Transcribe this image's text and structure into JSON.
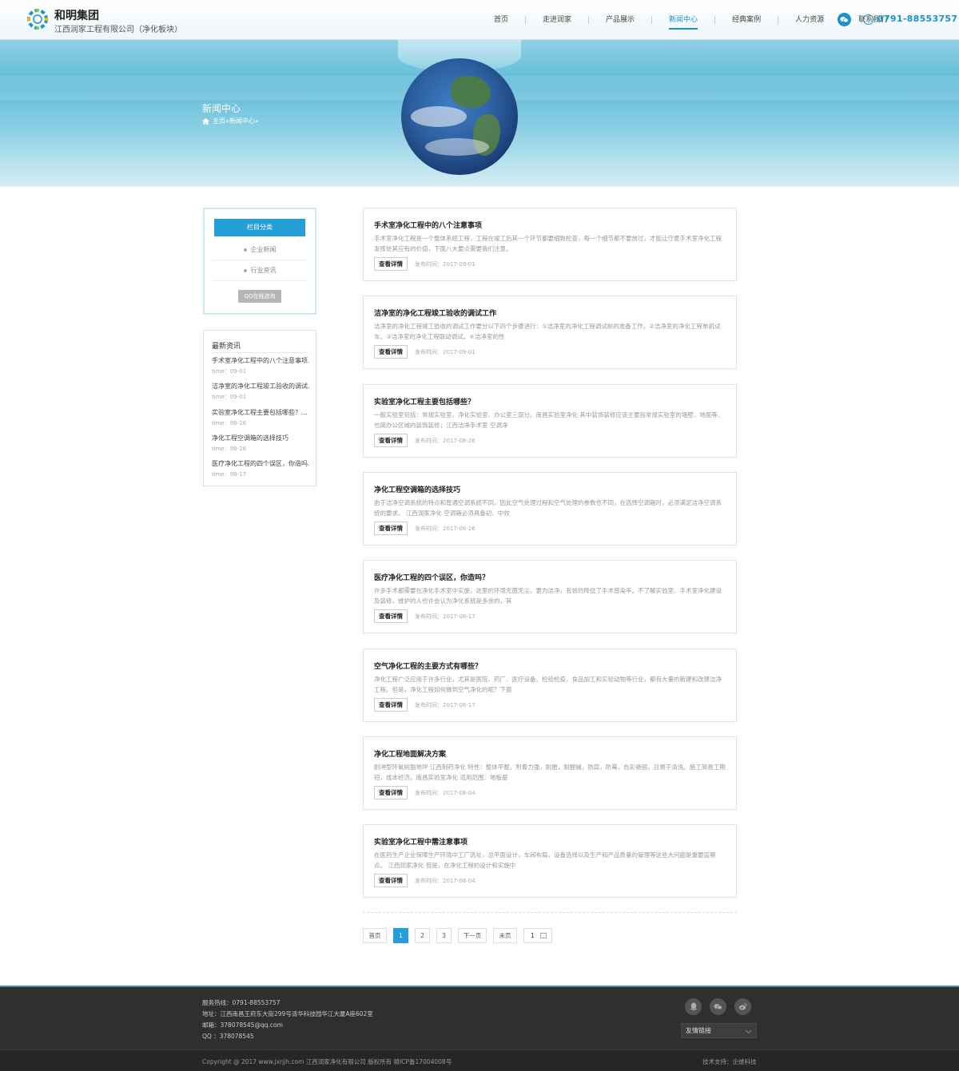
{
  "header": {
    "brand_title": "和明集团",
    "brand_sub": "江西润家工程有限公司（净化板块）",
    "phone": "0791-88553757",
    "accent": "#1a93c9"
  },
  "nav": [
    {
      "label": "首页",
      "active": false
    },
    {
      "label": "走进润家",
      "active": false
    },
    {
      "label": "产品展示",
      "active": false
    },
    {
      "label": "新闻中心",
      "active": true
    },
    {
      "label": "经典案例",
      "active": false
    },
    {
      "label": "人力资源",
      "active": false
    },
    {
      "label": "联系我们",
      "active": false
    }
  ],
  "banner": {
    "title": "新闻中心",
    "crumb_home": "主页",
    "crumb_sep1": " » ",
    "crumb_current": "新闻中心",
    "crumb_sep2": " »"
  },
  "sidebar": {
    "category_title": "栏目分类",
    "categories": [
      "企业新闻",
      "行业资讯"
    ],
    "qq_button": "QQ在线咨询",
    "latest_title": "最新资讯",
    "latest": [
      {
        "title": "手术室净化工程中的八个注意事项...",
        "date": "time：09-01"
      },
      {
        "title": "洁净室的净化工程竣工验收的调试...",
        "date": "time：09-01"
      },
      {
        "title": "实验室净化工程主要包括哪些？...",
        "date": "time：08-26"
      },
      {
        "title": "净化工程空调箱的选择技巧",
        "date": "time：08-26"
      },
      {
        "title": "医疗净化工程的四个误区，你造吗...",
        "date": "time：08-17"
      }
    ]
  },
  "articles": [
    {
      "title": "手术室净化工程中的八个注意事项",
      "desc": "手术室净化工程是一个整体系统工程，工程在竣工后其一个环节都要细致检查，每一个细节都不要放过，才能让守夏手术室净化工程发挥处其应有的价值，下面八大要点需要我们注意。",
      "more": "查看详情",
      "date": "发布时间：2017-09-01"
    },
    {
      "title": "洁净室的净化工程竣工验收的调试工作",
      "desc": "洁净室的净化工程竣工验收的调试工作要分以下四个步骤进行：①洁净室的净化工程调试前的准备工作。②洁净室的净化工程单机试车。③洁净室的净化工程联动调试。④洁净室的性",
      "more": "查看详情",
      "date": "发布时间：2017-09-01"
    },
    {
      "title": "实验室净化工程主要包括哪些？",
      "desc": "一般实验室包括：常规实验室、净化实验室、办公室三部分。南昌实验室净化 其中装饰装修应该主要指常规实验室的墙壁、地面等、也简办公区域的装饰装修；江西洁净手术室 空调净",
      "more": "查看详情",
      "date": "发布时间：2017-08-26"
    },
    {
      "title": "净化工程空调箱的选择技巧",
      "desc": "由于洁净空调系统的特点和普通空调系统不同，因此空气处理过程和空气处理的参数也不同，在选择空调箱时，必须满足洁净空调系统的要求。 江西润家净化 空调箱必须具备初、中效",
      "more": "查看详情",
      "date": "发布时间：2017-08-26"
    },
    {
      "title": "医疗净化工程的四个误区，你造吗？",
      "desc": "许多手术都需要在净化手术室中实施，这里的环境无菌无尘，更为洁净，有效的降低了手术感染率。不了解实验室、手术室净化建设及装修，维护的人也许会认为净化系统是多余的，其",
      "more": "查看详情",
      "date": "发布时间：2017-08-17"
    },
    {
      "title": "空气净化工程的主要方式有哪些？",
      "desc": "净化工程广泛应用于许多行业，尤其是医院、药厂、医疗设备、检验检疫、食品加工和实验动物等行业，都有大量的新建和改建洁净工程。但是，净化工程如何做到空气净化的呢？下面",
      "more": "查看详情",
      "date": "发布时间：2017-08-17"
    },
    {
      "title": "净化工程地面解决方案",
      "desc": "耐冲型环氧树脂地坪 江西制药净化 特性：整体平整，附着力强，耐磨，耐酸碱，防腐，防霉，色彩艳丽，且易于清洗。施工简易工期短，成本经济。南昌实验室净化 适用范围：地板基",
      "more": "查看详情",
      "date": "发布时间：2017-08-04"
    },
    {
      "title": "实验室净化工程中需注意事项",
      "desc": "在医药生产企业保障生产环境中工厂选址，总平面设计，车间布局，设备选择以及生产和产品质量的管理等这些大问题是重要监察点。 江西润家净化 但是，在净化工程的设计和实施中",
      "more": "查看详情",
      "date": "发布时间：2017-08-04"
    }
  ],
  "pager": {
    "first": "首页",
    "pages": [
      "1",
      "2",
      "3"
    ],
    "current": "1",
    "next": "下一页",
    "last": "末页",
    "select_value": "1"
  },
  "footer": {
    "hotline": "服务热线：0791-88553757",
    "address": "地址：江西南昌王府东大街299号清华科技园华江大厦A座602室",
    "email": "邮箱：378078545@qq.com",
    "qq": "QQ ：378078545",
    "friend_links": "友情链接",
    "copyright": "Copyright @ 2017 www.jxrjjh.com 江西润家净化有限公司 版权所有 赣ICP备17004008号",
    "tech": "技术支持：企维科技"
  }
}
